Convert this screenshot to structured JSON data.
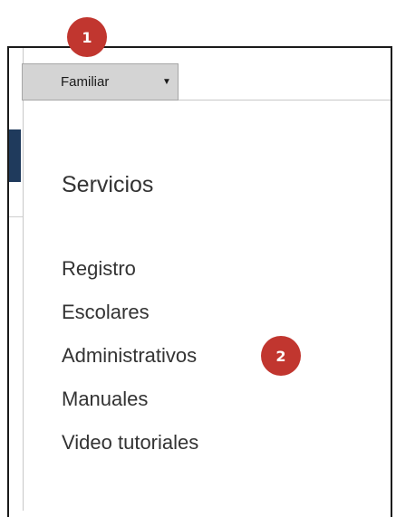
{
  "dropdown": {
    "selected": "Familiar",
    "arrow_icon": "▼"
  },
  "section": {
    "title": "Servicios"
  },
  "menu": {
    "items": [
      {
        "label": "Registro"
      },
      {
        "label": "Escolares"
      },
      {
        "label": "Administrativos"
      },
      {
        "label": "Manuales"
      },
      {
        "label": "Video tutoriales"
      }
    ]
  },
  "annotations": {
    "badge_1": "1",
    "badge_2": "2"
  },
  "colors": {
    "badge": "#c1362f",
    "dropdown_bg": "#d4d4d4",
    "sidebar_accent": "#1f3a5c",
    "text": "#333333"
  }
}
